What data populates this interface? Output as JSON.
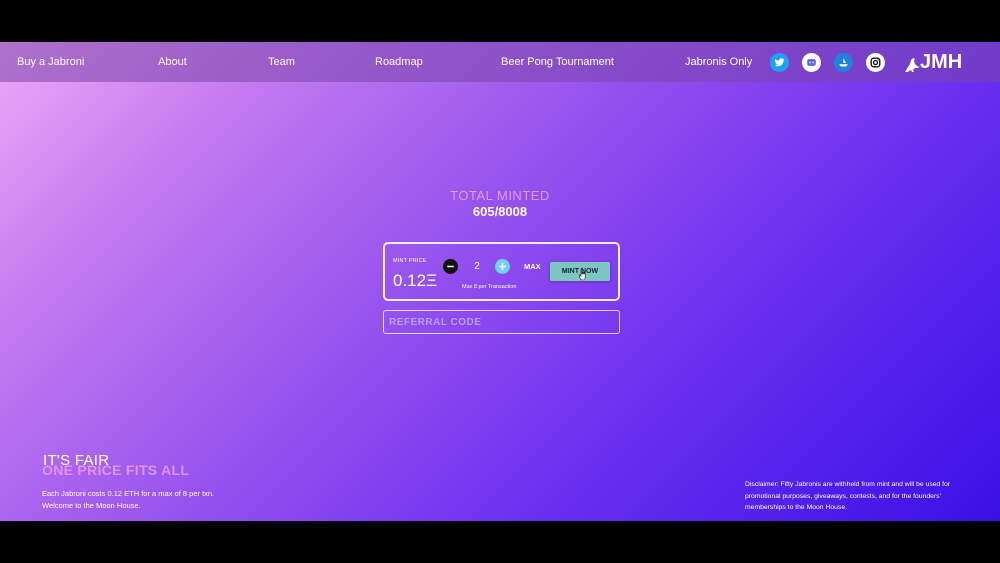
{
  "nav": {
    "links": [
      "Buy a Jabroni",
      "About",
      "Team",
      "Roadmap",
      "Beer Pong Tournament",
      "Jabronis Only"
    ],
    "icons": [
      "twitter-icon",
      "discord-icon",
      "opensea-icon",
      "instagram-icon"
    ],
    "logo_text": "JMH"
  },
  "mint": {
    "total_label": "TOTAL MINTED",
    "total_count": "605/8008",
    "price_label": "MINT PRICE",
    "price": "0.12Ξ",
    "quantity": "2",
    "max_label": "MAX",
    "button_label": "MINT NOW",
    "max_note": "Max 8 per Transaction"
  },
  "referral": {
    "placeholder": "REFERRAL CODE"
  },
  "fair": {
    "heading": "IT'S FAIR",
    "subheading": "ONE PRICE FITS ALL",
    "description_line1": "Each Jabroni costs 0.12 ETH for a max of 8 per txn.",
    "description_line2": "Welcome to the Moon House."
  },
  "disclaimer": {
    "text": "Disclaimer: Fifty Jabronis are withheld from mint and will be used for promotional purposes, giveaways, contests, and for the founders' memberships to the Moon House."
  },
  "colors": {
    "gradient_start": "#f2a8f6",
    "gradient_end": "#3a10e6",
    "mint_button": "#7dc6c2",
    "accent_pink": "#e59ae8",
    "plus_button": "#6fd2f7"
  }
}
